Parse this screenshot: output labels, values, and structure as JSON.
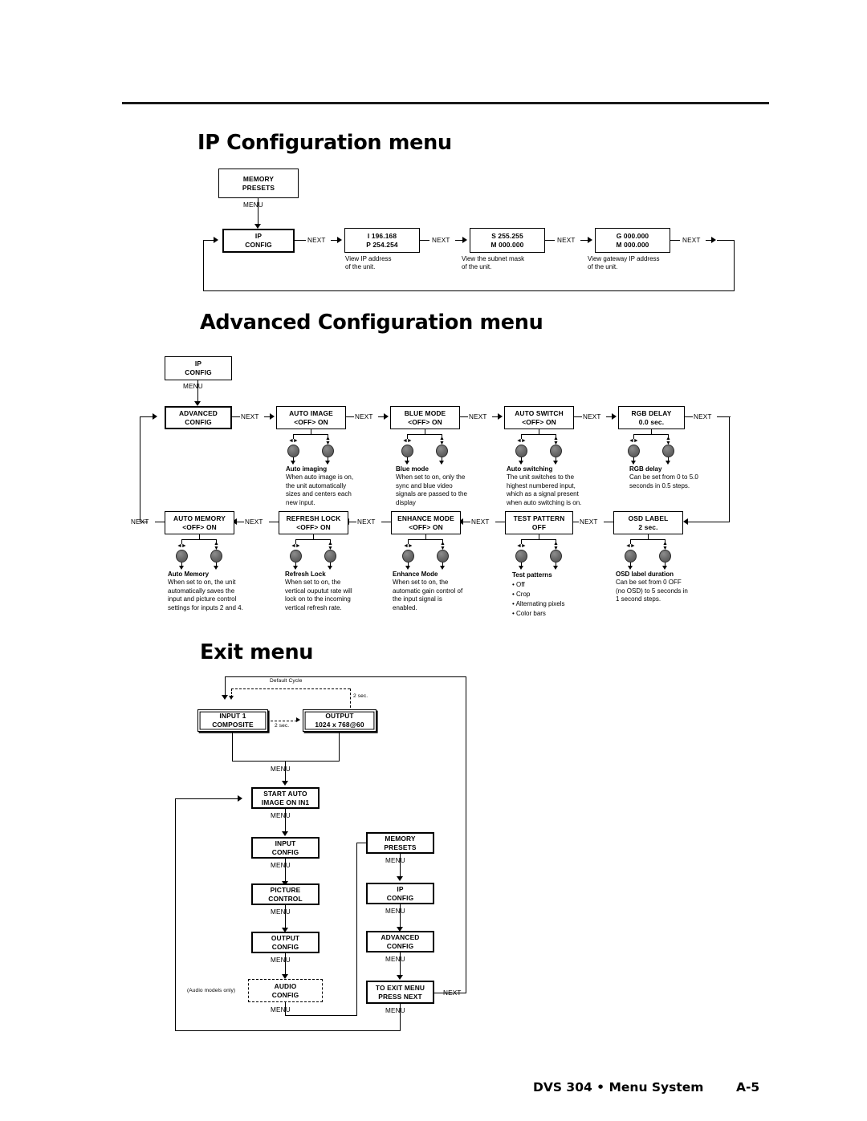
{
  "footer": {
    "doc_title": "DVS 304 • Menu System",
    "page_number": "A-5"
  },
  "sections": {
    "ip_config": {
      "heading": "IP Configuration menu",
      "boxes": {
        "memory_presets": {
          "line1": "MEMORY",
          "line2": "PRESETS"
        },
        "ip_config": {
          "line1": "IP",
          "line2": "CONFIG"
        },
        "ip_address": {
          "line1": "I  196.168",
          "line2": "P 254.254"
        },
        "subnet": {
          "line1": "S  255.255",
          "line2": "M 000.000"
        },
        "gateway": {
          "line1": "G  000.000",
          "line2": "M 000.000"
        }
      },
      "captions": {
        "ip_address": "View IP address\nof the unit.",
        "subnet": "View the subnet mask\nof the unit.",
        "gateway": "View gateway IP address\nof the unit."
      },
      "edge_labels": {
        "menu": "MENU",
        "next1": "NEXT",
        "next2": "NEXT",
        "next3": "NEXT",
        "next4": "NEXT"
      }
    },
    "advanced_config": {
      "heading": "Advanced Configuration menu",
      "boxes": {
        "ip_config": {
          "line1": "IP",
          "line2": "CONFIG"
        },
        "advanced_config": {
          "line1": "ADVANCED",
          "line2": "CONFIG"
        },
        "auto_image": {
          "line1": "AUTO IMAGE",
          "line2": "<OFF>    ON"
        },
        "blue_mode": {
          "line1": "BLUE MODE",
          "line2": "<OFF>    ON"
        },
        "auto_switch": {
          "line1": "AUTO SWITCH",
          "line2": "<OFF>    ON"
        },
        "rgb_delay": {
          "line1": "RGB DELAY",
          "line2": "0.0 sec."
        },
        "auto_memory": {
          "line1": "AUTO MEMORY",
          "line2": "<OFF>    ON"
        },
        "refresh_lock": {
          "line1": "REFRESH LOCK",
          "line2": "<OFF>    ON"
        },
        "enhance_mode": {
          "line1": "ENHANCE MODE",
          "line2": "<OFF>    ON"
        },
        "test_pattern": {
          "line1": "TEST PATTERN",
          "line2": "OFF"
        },
        "osd_label": {
          "line1": "OSD LABEL",
          "line2": "2 sec."
        }
      },
      "captions": {
        "auto_image": {
          "title": "Auto imaging",
          "body": "When auto image is on,\nthe unit automatically\nsizes and centers each\nnew input."
        },
        "blue_mode": {
          "title": "Blue mode",
          "body": "When set to on, only the\nsync and blue video\nsignals are passed to the\ndisplay"
        },
        "auto_switch": {
          "title": "Auto switching",
          "body": "The unit switches to the\nhighest numbered input,\nwhich as a signal present\nwhen auto switching is on."
        },
        "rgb_delay": {
          "title": "RGB delay",
          "body": "Can be set from 0 to 5.0\nseconds in 0.5 steps."
        },
        "auto_memory": {
          "title": "Auto Memory",
          "body": "When set to on, the unit\nautomatically saves the\ninput and picture control\nsettings for inputs 2 and 4."
        },
        "refresh_lock": {
          "title": "Refresh Lock",
          "body": "When set to on, the\nvertical ouputut rate will\nlock on to the incoming\nvertical refresh rate."
        },
        "enhance_mode": {
          "title": "Enhance Mode",
          "body": "When set to on, the\nautomatic gain control of\nthe input signal is\nenabled."
        },
        "test_pattern": {
          "title": "Test patterns",
          "body": "• Off\n• Crop\n• Alternating pixels\n• Color bars"
        },
        "osd_label": {
          "title": "OSD label duration",
          "body": "Can be set from 0 OFF\n(no OSD) to 5 seconds in\n1 second steps."
        }
      },
      "edge_labels": {
        "menu": "MENU",
        "next_r1_1": "NEXT",
        "next_r1_2": "NEXT",
        "next_r1_3": "NEXT",
        "next_r1_4": "NEXT",
        "next_r1_5": "NEXT",
        "next_r2_1": "NEXT",
        "next_r2_2": "NEXT",
        "next_r2_3": "NEXT",
        "next_r2_4": "NEXT",
        "next_r2_5": "NEXT"
      },
      "knob_glyphs": {
        "horizontal": "◄►",
        "vertical": "▲▼"
      }
    },
    "exit_menu": {
      "heading": "Exit menu",
      "boxes": {
        "input1": {
          "line1": "INPUT 1",
          "line2": "COMPOSITE"
        },
        "output": {
          "line1": "OUTPUT",
          "line2": "1024 x 768@60"
        },
        "start_auto_image": {
          "line1": "START AUTO",
          "line2": "IMAGE ON IN1"
        },
        "input_config": {
          "line1": "INPUT",
          "line2": "CONFIG"
        },
        "picture_control": {
          "line1": "PICTURE",
          "line2": "CONTROL"
        },
        "output_config": {
          "line1": "OUTPUT",
          "line2": "CONFIG"
        },
        "audio_config": {
          "line1": "AUDIO",
          "line2": "CONFIG"
        },
        "memory_presets": {
          "line1": "MEMORY",
          "line2": "PRESETS"
        },
        "ip_config": {
          "line1": "IP",
          "line2": "CONFIG"
        },
        "advanced_config": {
          "line1": "ADVANCED",
          "line2": "CONFIG"
        },
        "to_exit_menu": {
          "line1": "TO EXIT MENU",
          "line2": "PRESS NEXT"
        }
      },
      "edge_labels": {
        "default_cycle": "Default Cycle",
        "two_sec_h": "2 sec.",
        "two_sec_v": "2 sec.",
        "menu_top": "MENU",
        "menu_l1": "MENU",
        "menu_l2": "MENU",
        "menu_l3": "MENU",
        "menu_l4": "MENU",
        "menu_l5": "MENU",
        "menu_r1": "MENU",
        "menu_r2": "MENU",
        "menu_r3": "MENU",
        "menu_r4": "MENU",
        "next": "NEXT",
        "audio_note": "(Audio models only)"
      }
    }
  }
}
